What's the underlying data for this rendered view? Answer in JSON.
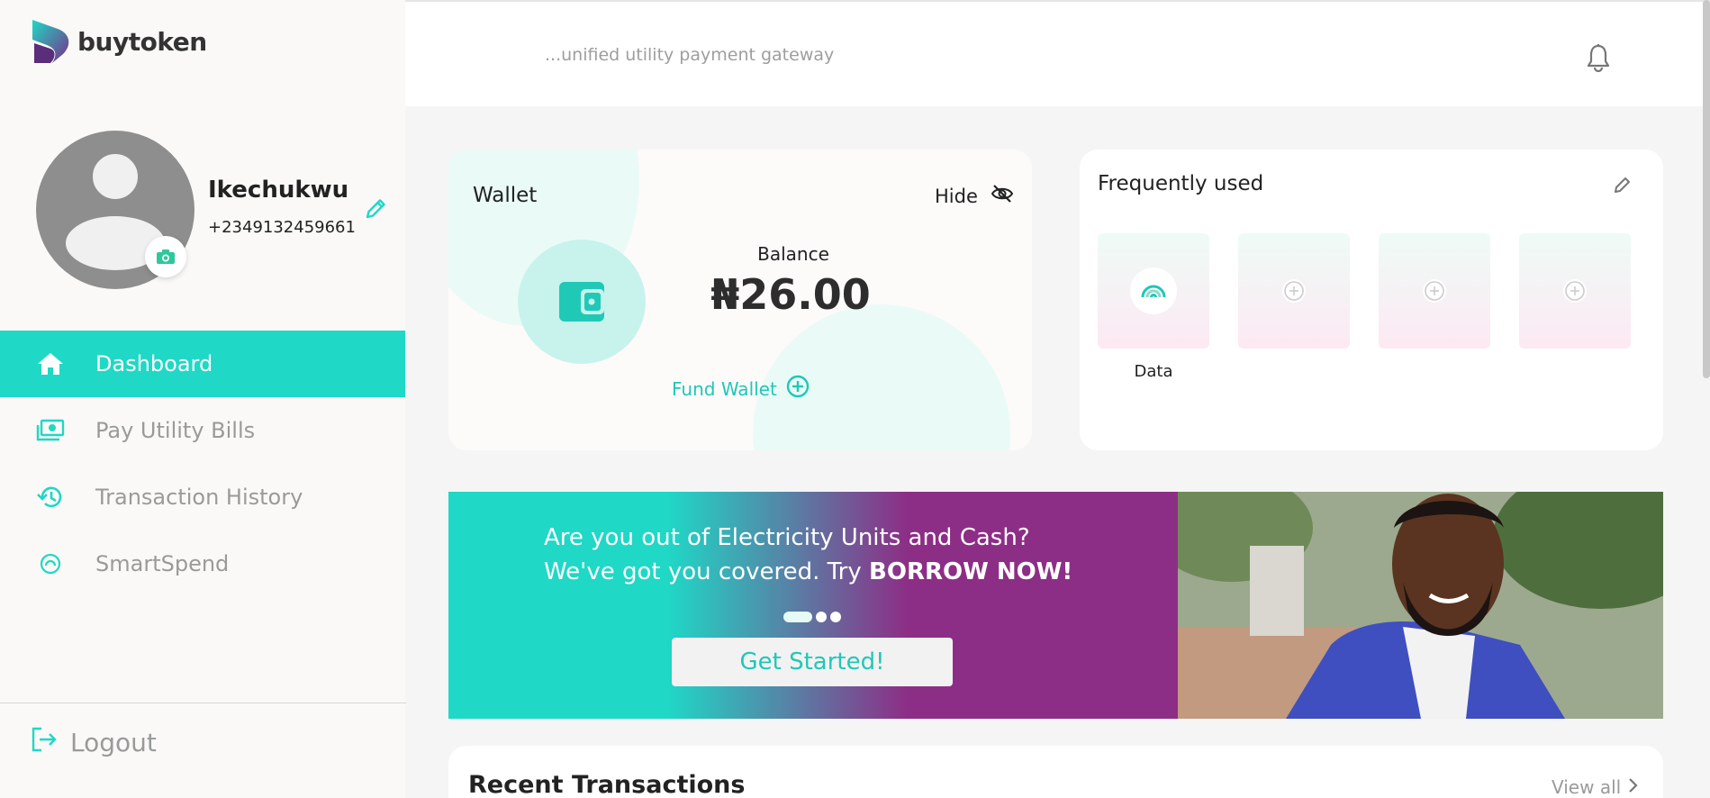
{
  "app": {
    "brand": "buytoken",
    "tagline": "...unified utility payment gateway"
  },
  "profile": {
    "name": "Ikechukwu",
    "phone": "+2349132459661"
  },
  "sidebar": {
    "items": [
      {
        "label": "Dashboard",
        "icon": "home-icon",
        "active": true
      },
      {
        "label": "Pay Utility Bills",
        "icon": "money-icon",
        "active": false
      },
      {
        "label": "Transaction History",
        "icon": "history-icon",
        "active": false
      },
      {
        "label": "SmartSpend",
        "icon": "gauge-icon",
        "active": false
      }
    ],
    "logout_label": "Logout"
  },
  "wallet": {
    "title": "Wallet",
    "hide_label": "Hide",
    "balance_label": "Balance",
    "balance": "₦26.00",
    "fund_label": "Fund Wallet"
  },
  "frequently_used": {
    "title": "Frequently used",
    "tiles": [
      {
        "label": "Data",
        "icon": "signal-icon"
      },
      {
        "label": "",
        "icon": "plus-circle-icon"
      },
      {
        "label": "",
        "icon": "plus-circle-icon"
      },
      {
        "label": "",
        "icon": "plus-circle-icon"
      }
    ]
  },
  "banner": {
    "line1": "Are you out of Electricity Units and Cash?",
    "line2_prefix": "We've got you covered. Try ",
    "line2_bold": "BORROW NOW!",
    "cta": "Get Started!",
    "slide_count": 3,
    "active_slide": 1
  },
  "recent": {
    "title": "Recent Transactions",
    "view_all": "View all"
  },
  "colors": {
    "accent": "#1fd8c6",
    "purple": "#8d2e86",
    "muted_text": "#9a9a9a"
  }
}
